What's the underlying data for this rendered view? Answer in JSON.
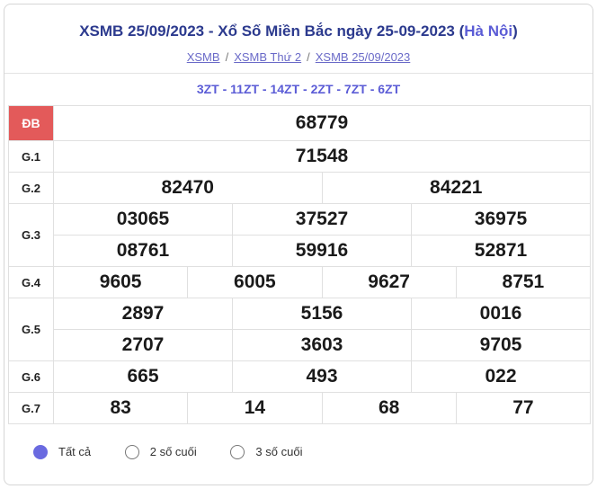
{
  "header": {
    "title_main": "XSMB 25/09/2023 - Xổ Số Miền Bắc ngày 25-09-2023 (",
    "title_region": "Hà Nội",
    "title_close": ")"
  },
  "breadcrumb": [
    "XSMB",
    "XSMB Thứ 2",
    "XSMB 25/09/2023"
  ],
  "codes": "3ZT - 11ZT - 14ZT - 2ZT - 7ZT - 6ZT",
  "prizes": {
    "db": {
      "label": "ĐB",
      "numbers": [
        "68779"
      ]
    },
    "g1": {
      "label": "G.1",
      "numbers": [
        "71548"
      ]
    },
    "g2": {
      "label": "G.2",
      "numbers": [
        "82470",
        "84221"
      ]
    },
    "g3": {
      "label": "G.3",
      "numbers": [
        "03065",
        "37527",
        "36975",
        "08761",
        "59916",
        "52871"
      ]
    },
    "g4": {
      "label": "G.4",
      "numbers": [
        "9605",
        "6005",
        "9627",
        "8751"
      ]
    },
    "g5": {
      "label": "G.5",
      "numbers": [
        "2897",
        "5156",
        "0016",
        "2707",
        "3603",
        "9705"
      ]
    },
    "g6": {
      "label": "G.6",
      "numbers": [
        "665",
        "493",
        "022"
      ]
    },
    "g7": {
      "label": "G.7",
      "numbers": [
        "83",
        "14",
        "68",
        "77"
      ]
    }
  },
  "filters": [
    {
      "label": "Tất cả",
      "selected": true
    },
    {
      "label": "2 số cuối",
      "selected": false
    },
    {
      "label": "3 số cuối",
      "selected": false
    }
  ],
  "colors": {
    "accent": "#5b5cd6",
    "special_bg": "#e35a5a",
    "special_text": "#d81e1e",
    "title": "#2c3a8e"
  }
}
